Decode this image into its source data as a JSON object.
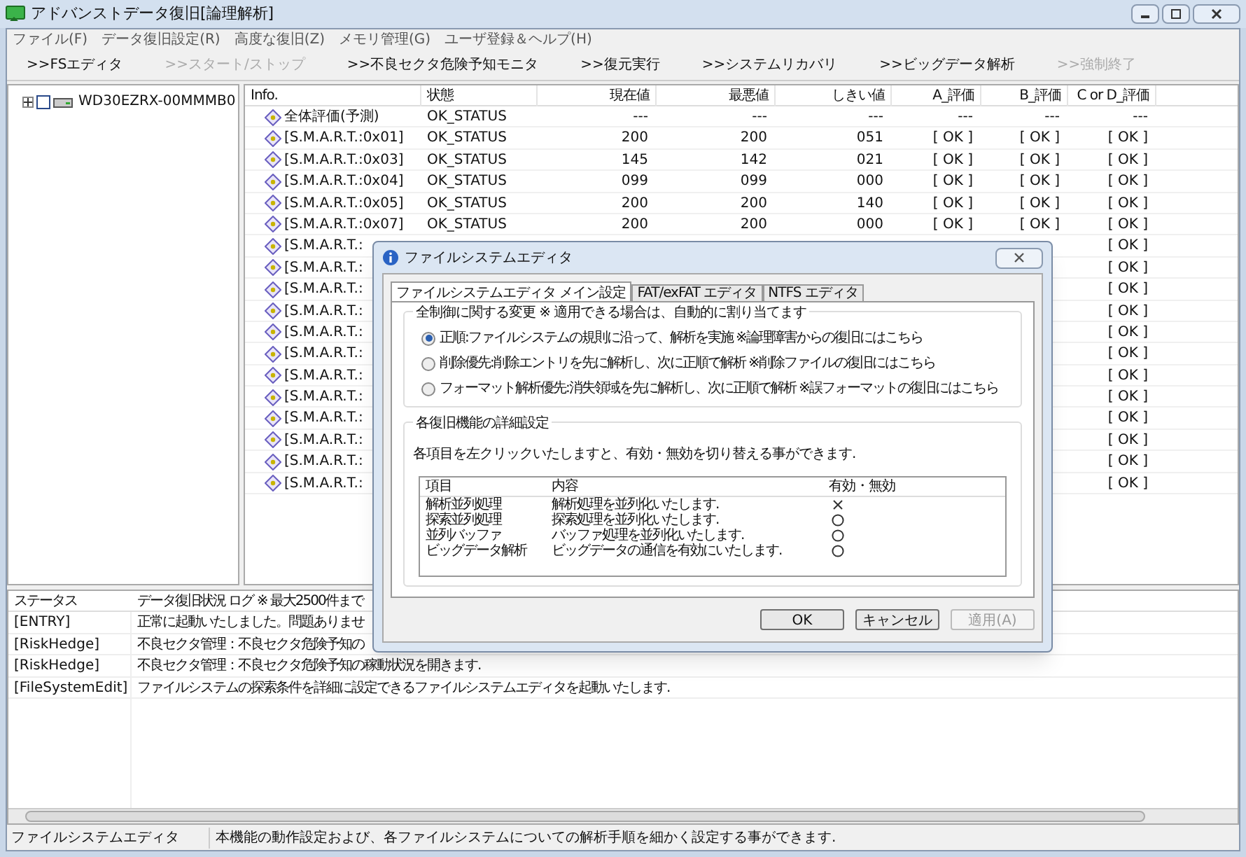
{
  "window": {
    "title": "アドバンストデータ復旧[論理解析]"
  },
  "menu": [
    "ファイル(F)",
    "データ復旧設定(R)",
    "高度な復旧(Z)",
    "メモリ管理(G)",
    "ユーザ登録＆ヘルプ(H)"
  ],
  "toolbar": [
    {
      "label": ">>FSエディタ",
      "disabled": false
    },
    {
      "label": ">>スタート/ストップ",
      "disabled": true
    },
    {
      "label": ">>不良セクタ危険予知モニタ",
      "disabled": false
    },
    {
      "label": ">>復元実行",
      "disabled": false
    },
    {
      "label": ">>システムリカバリ",
      "disabled": false
    },
    {
      "label": ">>ビッグデータ解析",
      "disabled": false
    },
    {
      "label": ">>強制終了",
      "disabled": true
    }
  ],
  "tree": [
    {
      "label": "WD30EZRX-00MMMB0",
      "expanded": false,
      "checked": false
    }
  ],
  "table": {
    "columns": [
      "Info.",
      "状態",
      "現在値",
      "最悪値",
      "しきい値",
      "A_評価",
      "B_評価",
      "C or D_評価"
    ],
    "rows": [
      {
        "info": "全体評価(予測)",
        "status": "OK_STATUS",
        "current": "---",
        "worst": "---",
        "threshold": "---",
        "a": "---",
        "b": "---",
        "c": "---"
      },
      {
        "info": "[S.M.A.R.T.:0x01]",
        "status": "OK_STATUS",
        "current": "200",
        "worst": "200",
        "threshold": "051",
        "a": "[ OK ]",
        "b": "[ OK ]",
        "c": "[ OK ]"
      },
      {
        "info": "[S.M.A.R.T.:0x03]",
        "status": "OK_STATUS",
        "current": "145",
        "worst": "142",
        "threshold": "021",
        "a": "[ OK ]",
        "b": "[ OK ]",
        "c": "[ OK ]"
      },
      {
        "info": "[S.M.A.R.T.:0x04]",
        "status": "OK_STATUS",
        "current": "099",
        "worst": "099",
        "threshold": "000",
        "a": "[ OK ]",
        "b": "[ OK ]",
        "c": "[ OK ]"
      },
      {
        "info": "[S.M.A.R.T.:0x05]",
        "status": "OK_STATUS",
        "current": "200",
        "worst": "200",
        "threshold": "140",
        "a": "[ OK ]",
        "b": "[ OK ]",
        "c": "[ OK ]"
      },
      {
        "info": "[S.M.A.R.T.:0x07]",
        "status": "OK_STATUS",
        "current": "200",
        "worst": "200",
        "threshold": "000",
        "a": "[ OK ]",
        "b": "[ OK ]",
        "c": "[ OK ]"
      },
      {
        "info": "[S.M.A.R.T.:",
        "c": "[ OK ]"
      },
      {
        "info": "[S.M.A.R.T.:",
        "c": "[ OK ]"
      },
      {
        "info": "[S.M.A.R.T.:",
        "c": "[ OK ]"
      },
      {
        "info": "[S.M.A.R.T.:",
        "c": "[ OK ]"
      },
      {
        "info": "[S.M.A.R.T.:",
        "c": "[ OK ]"
      },
      {
        "info": "[S.M.A.R.T.:",
        "c": "[ OK ]"
      },
      {
        "info": "[S.M.A.R.T.:",
        "c": "[ OK ]"
      },
      {
        "info": "[S.M.A.R.T.:",
        "c": "[ OK ]"
      },
      {
        "info": "[S.M.A.R.T.:",
        "c": "[ OK ]"
      },
      {
        "info": "[S.M.A.R.T.:",
        "c": "[ OK ]"
      },
      {
        "info": "[S.M.A.R.T.:",
        "c": "[ OK ]"
      },
      {
        "info": "[S.M.A.R.T.:",
        "c": "[ OK ]"
      }
    ]
  },
  "log": {
    "columns": [
      "ステータス",
      "データ復旧状況 ログ ※ 最大2500件まで"
    ],
    "rows": [
      {
        "status": "[ENTRY]",
        "message": "正常に起動いたしました。問題ありませ"
      },
      {
        "status": "[RiskHedge]",
        "message": "不良セクタ管理：不良セクタ危険予知の"
      },
      {
        "status": "[RiskHedge]",
        "message": "不良セクタ管理：不良セクタ危険予知の稼動状況を開きます."
      },
      {
        "status": "[FileSystemEdit]",
        "message": "ファイルシステムの探索条件を詳細に設定できるファイルシステムエディタを起動いたします."
      }
    ]
  },
  "status_bar": {
    "label": "ファイルシステムエディタ",
    "text": "本機能の動作設定および、各ファイルシステムについての解析手順を細かく設定する事ができます."
  },
  "dialog": {
    "title": "ファイルシステムエディタ",
    "tabs": [
      {
        "label": "ファイルシステムエディタ メイン設定",
        "selected": true
      },
      {
        "label": "FAT/exFAT エディタ",
        "selected": false
      },
      {
        "label": "NTFS エディタ",
        "selected": false
      }
    ],
    "group1": {
      "title": "全制御に関する変更 ※ 適用できる場合は、自動的に割り当てます",
      "options": [
        {
          "label": "正順:ファイルシステムの規則に沿って、解析を実施 ※論理障害からの復旧にはこちら",
          "selected": true
        },
        {
          "label": "削除優先:削除エントリを先に解析し、次に正順で解析 ※削除ファイルの復旧にはこちら",
          "selected": false
        },
        {
          "label": "フォーマット解析優先:消失領域を先に解析し、次に正順で解析 ※誤フォーマットの復旧にはこちら",
          "selected": false
        }
      ]
    },
    "group2": {
      "title": "各復旧機能の詳細設定",
      "note": "各項目を左クリックいたしますと、有効・無効を切り替える事ができます.",
      "columns": [
        "項目",
        "内容",
        "有効・無効"
      ],
      "rows": [
        {
          "item": "解析並列処理",
          "content": "解析処理を並列化いたします.",
          "enabled": false
        },
        {
          "item": "探索並列処理",
          "content": "探索処理を並列化いたします.",
          "enabled": true
        },
        {
          "item": "並列バッファ",
          "content": "バッファ処理を並列化いたします.",
          "enabled": true
        },
        {
          "item": "ビッグデータ解析",
          "content": "ビッグデータの通信を有効にいたします.",
          "enabled": true
        }
      ]
    },
    "buttons": [
      {
        "label": "OK",
        "disabled": false
      },
      {
        "label": "キャンセル",
        "disabled": false
      },
      {
        "label": "適用(A)",
        "disabled": true
      }
    ]
  }
}
